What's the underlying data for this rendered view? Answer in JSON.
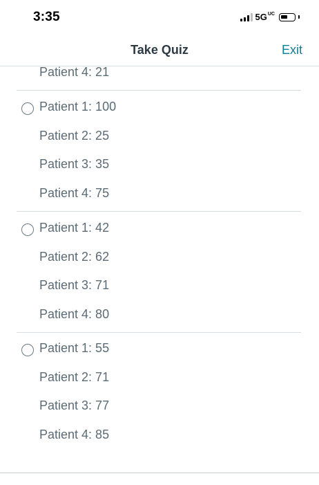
{
  "status_bar": {
    "time": "3:35",
    "network": "5G",
    "network_badge": "UC",
    "icons": [
      "signal-icon",
      "battery-icon"
    ]
  },
  "nav": {
    "title": "Take Quiz",
    "exit_label": "Exit"
  },
  "partial_option": {
    "lines": [
      "Patient 4: 21"
    ]
  },
  "options": [
    {
      "lines": [
        "Patient 1: 100",
        "Patient 2: 25",
        "Patient 3: 35",
        "Patient 4: 75"
      ]
    },
    {
      "lines": [
        "Patient 1: 42",
        "Patient 2: 62",
        "Patient 3: 71",
        "Patient 4: 80"
      ]
    },
    {
      "lines": [
        "Patient 1: 55",
        "Patient 2: 71",
        "Patient 3: 77",
        "Patient 4: 85"
      ]
    }
  ],
  "colors": {
    "accent": "#0c7e9a",
    "text": "#2d3b45",
    "muted_text": "#5b6b75",
    "divider": "#d8dde2"
  }
}
